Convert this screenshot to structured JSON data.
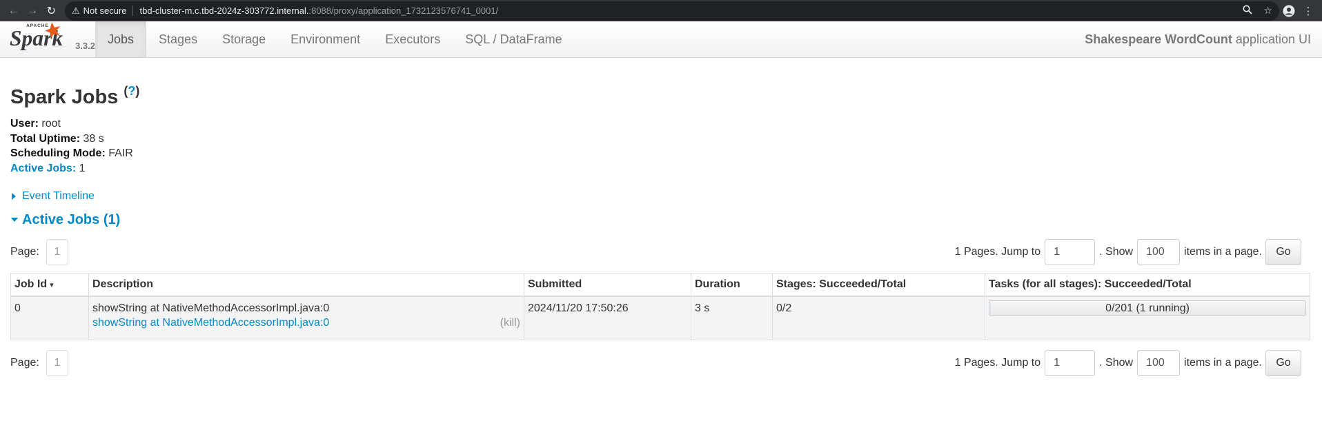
{
  "browser": {
    "security_label": "Not secure",
    "url_host": "tbd-cluster-m.c.tbd-2024z-303772.internal.",
    "url_path": ":8088/proxy/application_1732123576741_0001/"
  },
  "navbar": {
    "brand_small": "APACHE",
    "brand": "Spark",
    "version": "3.3.2",
    "tabs": [
      {
        "label": "Jobs",
        "active": true
      },
      {
        "label": "Stages"
      },
      {
        "label": "Storage"
      },
      {
        "label": "Environment"
      },
      {
        "label": "Executors"
      },
      {
        "label": "SQL / DataFrame"
      }
    ],
    "app_name": "Shakespeare WordCount",
    "app_suffix": "application UI"
  },
  "page": {
    "title": "Spark Jobs",
    "help_paren_open": "(",
    "help": "?",
    "help_paren_close": ")",
    "summary": {
      "user_label": "User:",
      "user_value": "root",
      "uptime_label": "Total Uptime:",
      "uptime_value": "38 s",
      "sched_label": "Scheduling Mode:",
      "sched_value": "FAIR",
      "active_label": "Active Jobs:",
      "active_value": "1"
    },
    "event_timeline": "Event Timeline",
    "active_jobs_header": "Active Jobs (1)"
  },
  "pager": {
    "page_label": "Page:",
    "page_number": "1",
    "pages_text": "1 Pages. Jump to",
    "jump_value": "1",
    "show_text": ". Show",
    "show_value": "100",
    "items_text": "items in a page.",
    "go_label": "Go"
  },
  "table": {
    "headers": {
      "job_id": "Job Id",
      "sort_caret": "▾",
      "description": "Description",
      "submitted": "Submitted",
      "duration": "Duration",
      "stages": "Stages: Succeeded/Total",
      "tasks": "Tasks (for all stages): Succeeded/Total"
    },
    "rows": [
      {
        "job_id": "0",
        "description": "showString at NativeMethodAccessorImpl.java:0",
        "description_link": "showString at NativeMethodAccessorImpl.java:0",
        "kill": "(kill)",
        "submitted": "2024/11/20 17:50:26",
        "duration": "3 s",
        "stages": "0/2",
        "tasks": "0/201 (1 running)",
        "tasks_succeeded": 0,
        "tasks_running": 1,
        "tasks_total": 201
      }
    ]
  },
  "colors": {
    "link": "#0088cc",
    "browser_bar": "#35363a",
    "spark_orange": "#e25a1c",
    "spark_text": "#3c3a3e"
  }
}
